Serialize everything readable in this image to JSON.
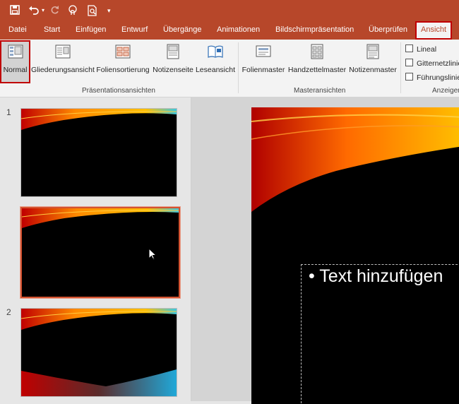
{
  "qat": {
    "icons": [
      "save-icon",
      "undo-icon",
      "redo-icon",
      "touch-mode-icon",
      "print-preview-icon",
      "customize-qat-icon"
    ]
  },
  "tabs": [
    "Datei",
    "Start",
    "Einfügen",
    "Entwurf",
    "Übergänge",
    "Animationen",
    "Bildschirmpräsentation",
    "Überprüfen",
    "Ansicht"
  ],
  "active_tab": "Ansicht",
  "ribbon": {
    "praesentation": {
      "label": "Präsentationsansichten",
      "buttons": [
        "Normal",
        "Gliederungsansicht",
        "Foliensortierung",
        "Notizenseite",
        "Leseansicht"
      ]
    },
    "master": {
      "label": "Masteransichten",
      "buttons": [
        "Folienmaster",
        "Handzettelmaster",
        "Notizenmaster"
      ]
    },
    "anzeigen": {
      "label": "Anzeigen",
      "checks": [
        "Lineal",
        "Gitternetzlinien",
        "Führungslinien"
      ]
    }
  },
  "thumbnails": {
    "numbers": [
      "1",
      "2"
    ]
  },
  "slide": {
    "placeholder_text": "• Text hinzufügen"
  },
  "colors": {
    "accent": "#b7472a",
    "selection": "#d35230",
    "highlight_box": "#c00000"
  }
}
